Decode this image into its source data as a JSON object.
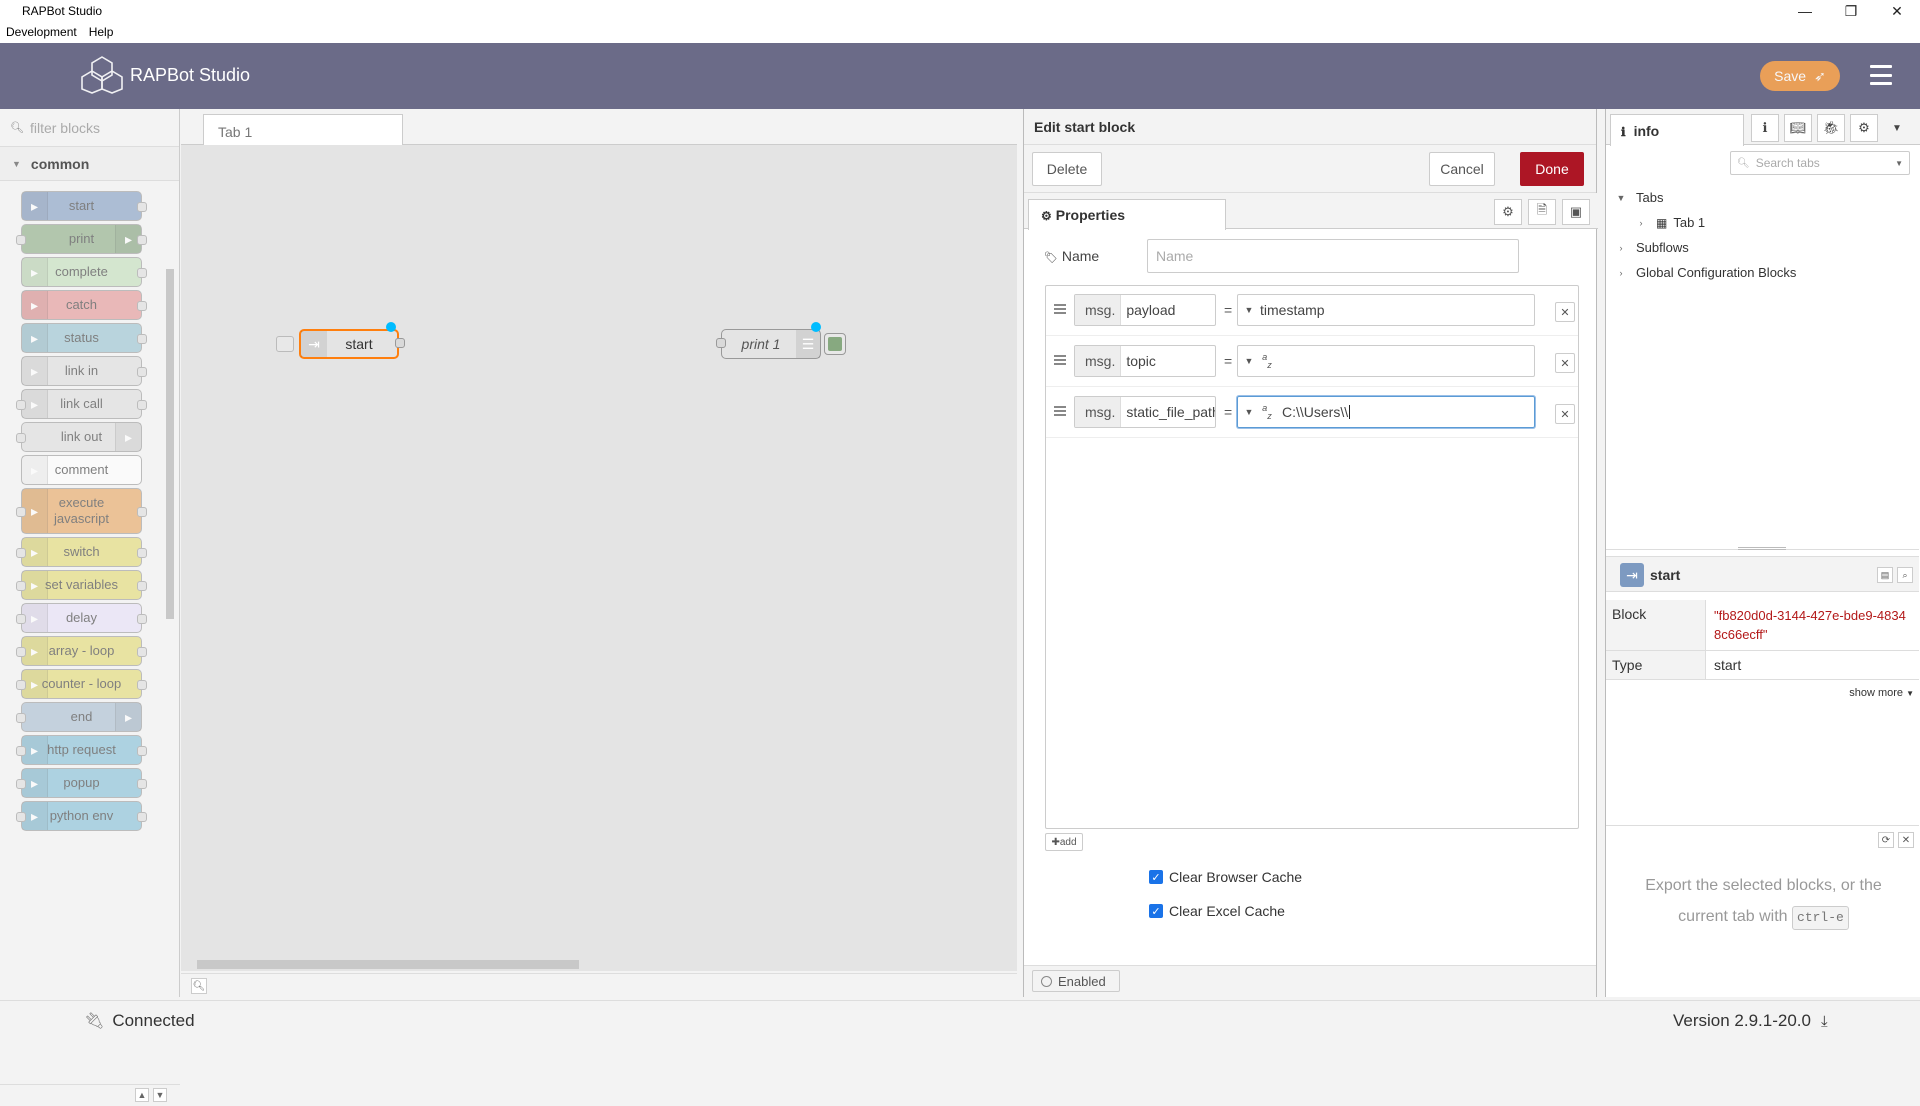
{
  "window": {
    "title": "RAPBot Studio",
    "controls": [
      "—",
      "❐",
      "✕"
    ]
  },
  "menubar": [
    "Development",
    "Help"
  ],
  "header": {
    "brand": "RAPBot Studio",
    "save_label": "Save"
  },
  "palette": {
    "filter_placeholder": "filter blocks",
    "category": "common",
    "nodes": [
      {
        "label": "start",
        "color": "#7d9ac1"
      },
      {
        "label": "print",
        "color": "#87a980"
      },
      {
        "label": "complete",
        "color": "#c0deb8"
      },
      {
        "label": "catch",
        "color": "#e49191"
      },
      {
        "label": "status",
        "color": "#94c1d0"
      },
      {
        "label": "link in",
        "color": "#dddddd"
      },
      {
        "label": "link call",
        "color": "#dddddd"
      },
      {
        "label": "link out",
        "color": "#dddddd"
      },
      {
        "label": "comment",
        "color": "#ffffff"
      },
      {
        "label": "execute javascript",
        "color": "#e7a35b"
      },
      {
        "label": "switch",
        "color": "#e2d96e"
      },
      {
        "label": "set variables",
        "color": "#e2d96e"
      },
      {
        "label": "delay",
        "color": "#e6e0f8"
      },
      {
        "label": "array - loop",
        "color": "#e2d96e"
      },
      {
        "label": "counter - loop",
        "color": "#e2d96e"
      },
      {
        "label": "end",
        "color": "#a6bbcf"
      },
      {
        "label": "http request",
        "color": "#7fbdd6"
      },
      {
        "label": "popup",
        "color": "#7fbdd6"
      },
      {
        "label": "python env",
        "color": "#7fbdd6"
      }
    ]
  },
  "workspace": {
    "tab": "Tab 1",
    "nodes": [
      {
        "label": "start",
        "color": "#7d9ac1"
      },
      {
        "label": "print 1",
        "color": "#87a980"
      }
    ]
  },
  "editor": {
    "title": "Edit start block",
    "delete_label": "Delete",
    "cancel_label": "Cancel",
    "done_label": "Done",
    "properties_tab": "Properties",
    "name_label": "Name",
    "name_placeholder": "Name",
    "msg_prefix": "msg.",
    "rows": [
      {
        "key": "payload",
        "type": "",
        "value": "timestamp"
      },
      {
        "key": "topic",
        "type": "az",
        "value": ""
      },
      {
        "key": "static_file_path",
        "type": "az",
        "value": "C:\\\\Users\\\\"
      }
    ],
    "add_label": "add",
    "checkboxes": [
      {
        "label": "Clear Browser Cache",
        "checked": true
      },
      {
        "label": "Clear Excel Cache",
        "checked": true
      }
    ],
    "enabled_label": "Enabled"
  },
  "sidebar": {
    "tab_label": "info",
    "search_placeholder": "Search tabs",
    "tree": [
      {
        "label": "Tabs",
        "indent": 0
      },
      {
        "label": "Tab 1",
        "indent": 1
      },
      {
        "label": "Subflows",
        "indent": 0
      },
      {
        "label": "Global Configuration Blocks",
        "indent": 0
      }
    ],
    "node_name": "start",
    "info": [
      {
        "key": "Block",
        "value": "\"fb820d0d-3144-427e-bde9-48348c66ecff\""
      },
      {
        "key": "Type",
        "value": "start"
      }
    ],
    "show_more": "show more",
    "help_text": "Export the selected blocks, or the current tab with",
    "help_key": "ctrl-e"
  },
  "status": {
    "connection": "Connected",
    "version": "Version 2.9.1-20.0"
  }
}
